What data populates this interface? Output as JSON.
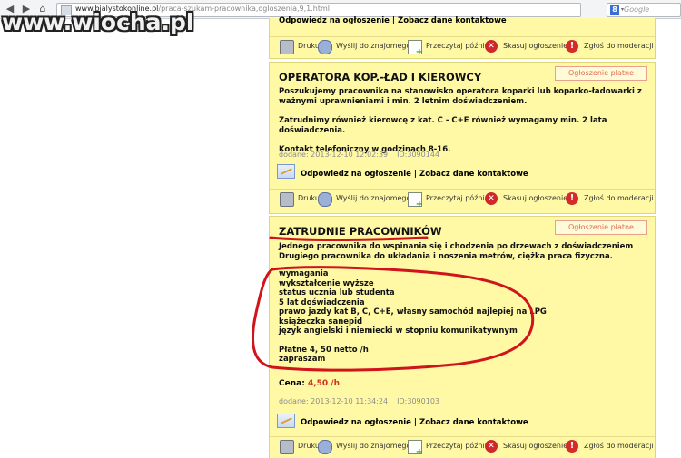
{
  "watermark": "www.wiocha.pl",
  "browser": {
    "url_host": "www.bialystokonline.pl",
    "url_path": "/praca-szukam-pracownika,ogloszenia,9,1.html",
    "search_placeholder": "Google",
    "search_engine_glyph": "8"
  },
  "tools": {
    "print": "Drukuj",
    "share": "Wyślij do znajomego",
    "later": "Przeczytaj później",
    "delete": "Skasuj ogłoszenie",
    "report": "Zgłoś do moderacji"
  },
  "ad_actions": {
    "reply": "Odpowiedz na ogłoszenie",
    "separator": "|",
    "contact": "Zobacz dane kontaktowe"
  },
  "paid_label": "Ogłoszenie płatne",
  "ads": [
    {
      "title": "OPERATORA KOP.-ŁAD I KIEROWCY",
      "lines": [
        "Poszukujemy pracownika na stanowisko operatora koparki lub koparko-ładowarki z ważnymi uprawnieniami i min. 2 letnim doświadczeniem.",
        "Zatrudnimy również kierowcę z kat. C - C+E również wymagamy min. 2 lata doświadczenia.",
        "Kontakt telefoniczny w godzinach 8-16."
      ],
      "date": "dodane: 2013-12-10 12:02:39",
      "id": "ID:3090144"
    },
    {
      "title": "ZATRUDNIE PRACOWNIKÓW",
      "intro": [
        "Jednego pracownika do wspinania się i chodzenia po drzewach z doświadczeniem",
        "Drugiego pracownika do układania i noszenia metrów, ciężka praca fizyczna."
      ],
      "requirements": [
        "wymagania",
        "wykształcenie wyższe",
        "status ucznia lub studenta",
        "5 lat doświadczenia",
        "prawo jazdy kat B, C, C+E, własny samochód najlepiej na LPG",
        "książeczka sanepid",
        "język angielski i niemiecki w stopniu komunikatywnym"
      ],
      "closing": [
        "Płatne 4, 50 netto /h",
        "zapraszam"
      ],
      "price_label": "Cena:",
      "price_value": "4,50 /h",
      "date": "dodane: 2013-12-10 11:34:24",
      "id": "ID:3090103"
    }
  ],
  "annotation_color": "#d0141b",
  "ad_background": "#fff9a6"
}
